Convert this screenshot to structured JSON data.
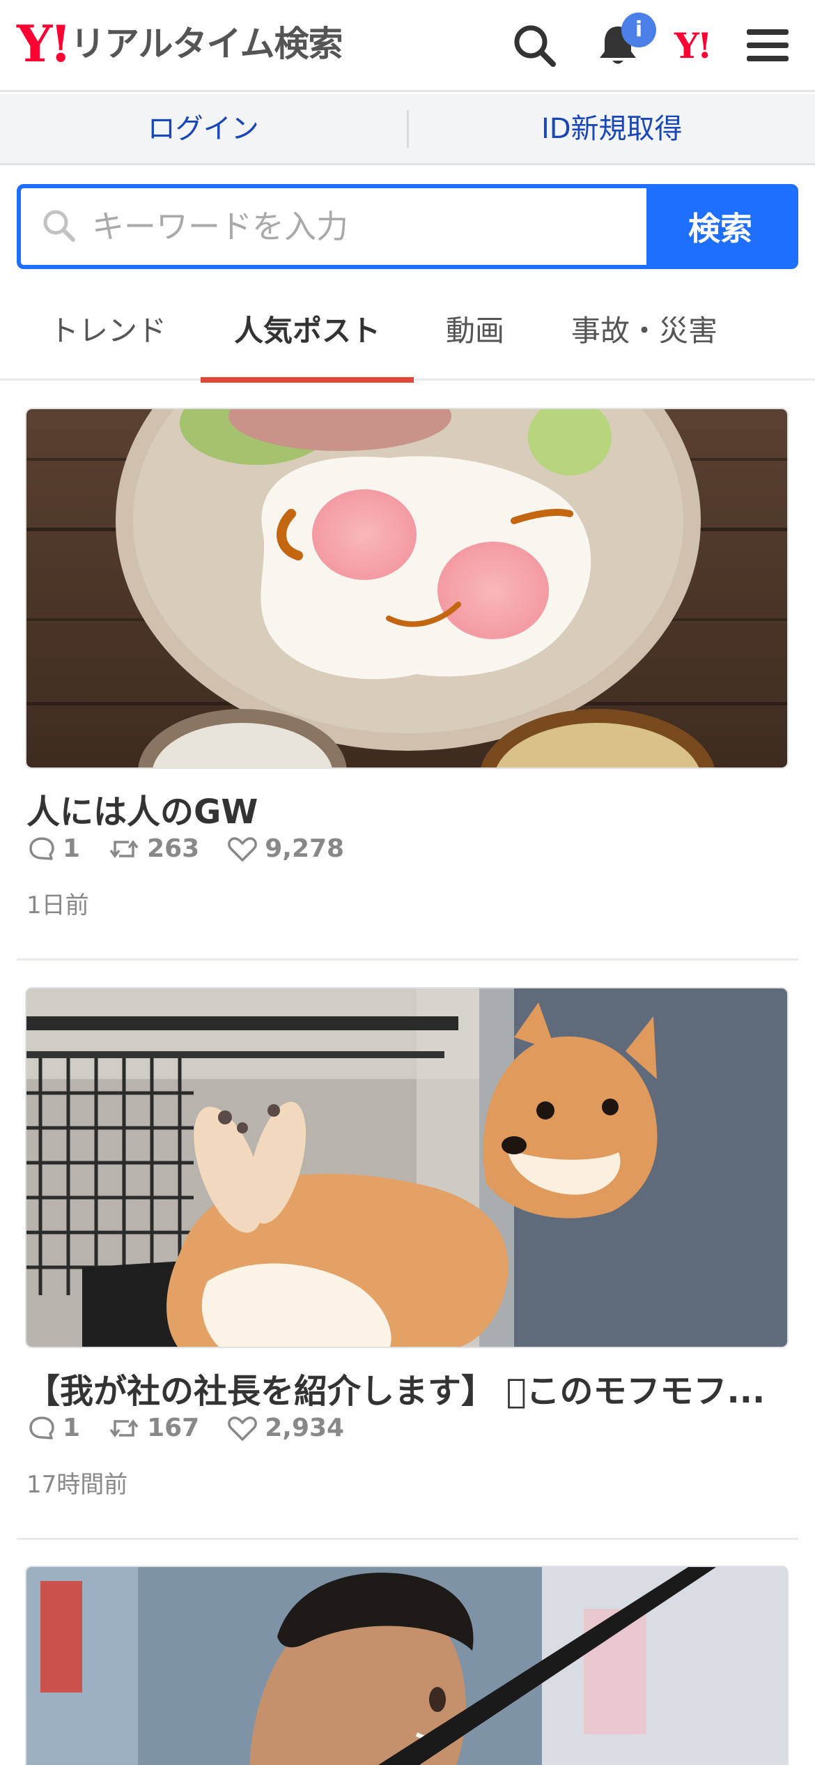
{
  "header": {
    "logo_mark": "Y!",
    "logo_text": "リアルタイム検索",
    "notification_badge": "i",
    "yahoo_mark": "Y!"
  },
  "login_bar": {
    "login": "ログイン",
    "register": "ID新規取得"
  },
  "search": {
    "placeholder": "キーワードを入力",
    "button": "検索"
  },
  "tabs": [
    {
      "label": "トレンド",
      "active": false
    },
    {
      "label": "人気ポスト",
      "active": true
    },
    {
      "label": "動画",
      "active": false
    },
    {
      "label": "事故・災害",
      "active": false
    }
  ],
  "posts": [
    {
      "title": "人には人のGW",
      "replies": "1",
      "reposts": "263",
      "likes": "9,278",
      "time": "1日前",
      "image": "fried-eggs-plate-photo"
    },
    {
      "title": "【我が社の社長を紹介します】 􀀀このモフモフ...",
      "replies": "1",
      "reposts": "167",
      "likes": "2,934",
      "time": "17時間前",
      "image": "shiba-dog-photo"
    },
    {
      "image": "baseball-player-photo"
    }
  ],
  "colors": {
    "brand_red": "#ff0033",
    "accent_blue": "#1f6fff",
    "link_blue": "#1a47b8",
    "tab_underline": "#e0483b"
  }
}
